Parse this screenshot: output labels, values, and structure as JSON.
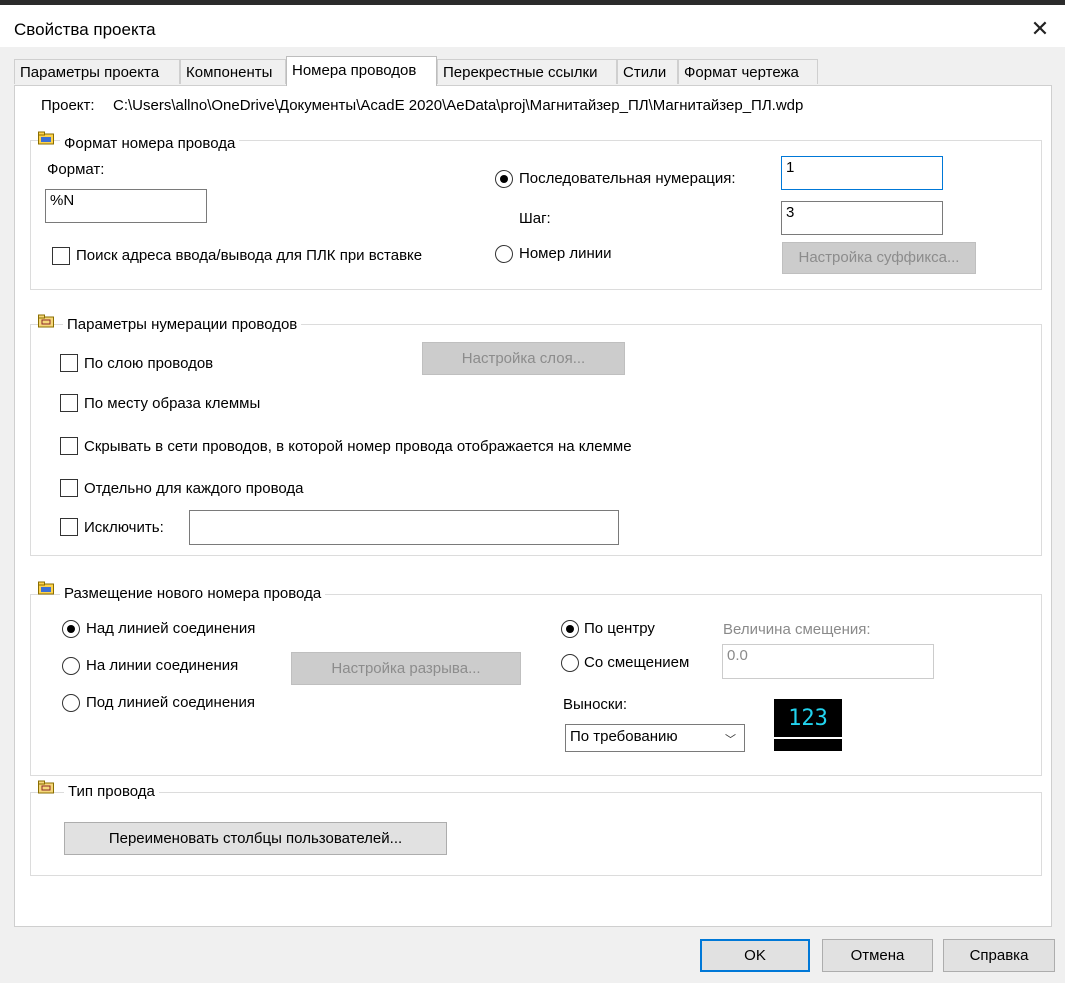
{
  "window": {
    "title": "Свойства проекта"
  },
  "tabs": [
    {
      "label": "Параметры проекта"
    },
    {
      "label": "Компоненты"
    },
    {
      "label": "Номера проводов"
    },
    {
      "label": "Перекрестные ссылки"
    },
    {
      "label": "Стили"
    },
    {
      "label": "Формат чертежа"
    }
  ],
  "project": {
    "label": "Проект:",
    "path": "C:\\Users\\allno\\OneDrive\\Документы\\AcadE 2020\\AeData\\proj\\Магнитайзер_ПЛ\\Магнитайзер_ПЛ.wdp"
  },
  "wire_format": {
    "legend": "Формат номера провода",
    "format_label": "Формат:",
    "format_value": "%N",
    "plc_search_label": "Поиск адреса ввода/вывода для ПЛК при вставке",
    "plc_search_checked": false,
    "sequential_label": "Последовательная нумерация:",
    "sequential_selected": true,
    "start_value": "1",
    "step_label": "Шаг:",
    "step_value": "3",
    "line_number_label": "Номер линии",
    "suffix_button": "Настройка суффикса..."
  },
  "numbering": {
    "legend": "Параметры нумерации проводов",
    "by_layer_label": "По слою проводов",
    "layer_button": "Настройка слоя...",
    "by_terminal_label": "По месту образа клеммы",
    "hide_label": "Скрывать в сети проводов, в которой номер провода отображается на клемме",
    "per_wire_label": "Отдельно для каждого провода",
    "exclude_label": "Исключить:",
    "exclude_value": ""
  },
  "placement": {
    "legend": "Размещение нового номера провода",
    "above_label": "Над линией соединения",
    "above_selected": true,
    "inline_label": "На линии соединения",
    "below_label": "Под линией соединения",
    "gap_button": "Настройка разрыва...",
    "center_label": "По центру",
    "center_selected": true,
    "offset_label": "Со смещением",
    "offset_value_label": "Величина смещения:",
    "offset_value": "0.0",
    "leaders_label": "Выноски:",
    "leaders_value": "По требованию",
    "preview_text": "123"
  },
  "wire_type": {
    "legend": "Тип провода",
    "rename_button": "Переименовать столбцы пользователей..."
  },
  "footer": {
    "ok": "OK",
    "cancel": "Отмена",
    "help": "Справка"
  },
  "colors": {
    "accent": "#0078d7",
    "preview_bg": "#000000",
    "preview_text": "#22d3ee"
  }
}
